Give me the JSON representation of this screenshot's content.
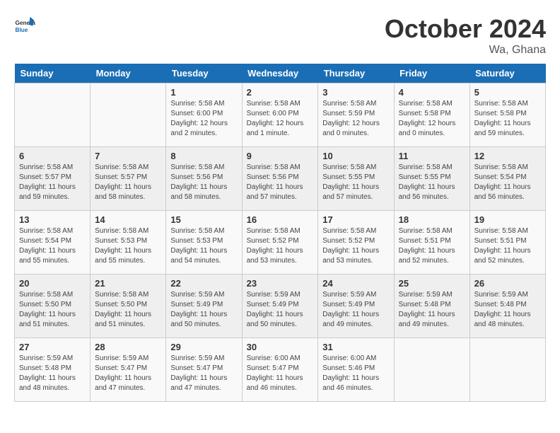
{
  "header": {
    "logo": {
      "line1": "General",
      "line2": "Blue"
    },
    "title": "October 2024",
    "location": "Wa, Ghana"
  },
  "weekdays": [
    "Sunday",
    "Monday",
    "Tuesday",
    "Wednesday",
    "Thursday",
    "Friday",
    "Saturday"
  ],
  "weeks": [
    [
      null,
      null,
      {
        "day": 1,
        "sunrise": "5:58 AM",
        "sunset": "6:00 PM",
        "daylight": "12 hours and 2 minutes."
      },
      {
        "day": 2,
        "sunrise": "5:58 AM",
        "sunset": "6:00 PM",
        "daylight": "12 hours and 1 minute."
      },
      {
        "day": 3,
        "sunrise": "5:58 AM",
        "sunset": "5:59 PM",
        "daylight": "12 hours and 0 minutes."
      },
      {
        "day": 4,
        "sunrise": "5:58 AM",
        "sunset": "5:58 PM",
        "daylight": "12 hours and 0 minutes."
      },
      {
        "day": 5,
        "sunrise": "5:58 AM",
        "sunset": "5:58 PM",
        "daylight": "11 hours and 59 minutes."
      }
    ],
    [
      {
        "day": 6,
        "sunrise": "5:58 AM",
        "sunset": "5:57 PM",
        "daylight": "11 hours and 59 minutes."
      },
      {
        "day": 7,
        "sunrise": "5:58 AM",
        "sunset": "5:57 PM",
        "daylight": "11 hours and 58 minutes."
      },
      {
        "day": 8,
        "sunrise": "5:58 AM",
        "sunset": "5:56 PM",
        "daylight": "11 hours and 58 minutes."
      },
      {
        "day": 9,
        "sunrise": "5:58 AM",
        "sunset": "5:56 PM",
        "daylight": "11 hours and 57 minutes."
      },
      {
        "day": 10,
        "sunrise": "5:58 AM",
        "sunset": "5:55 PM",
        "daylight": "11 hours and 57 minutes."
      },
      {
        "day": 11,
        "sunrise": "5:58 AM",
        "sunset": "5:55 PM",
        "daylight": "11 hours and 56 minutes."
      },
      {
        "day": 12,
        "sunrise": "5:58 AM",
        "sunset": "5:54 PM",
        "daylight": "11 hours and 56 minutes."
      }
    ],
    [
      {
        "day": 13,
        "sunrise": "5:58 AM",
        "sunset": "5:54 PM",
        "daylight": "11 hours and 55 minutes."
      },
      {
        "day": 14,
        "sunrise": "5:58 AM",
        "sunset": "5:53 PM",
        "daylight": "11 hours and 55 minutes."
      },
      {
        "day": 15,
        "sunrise": "5:58 AM",
        "sunset": "5:53 PM",
        "daylight": "11 hours and 54 minutes."
      },
      {
        "day": 16,
        "sunrise": "5:58 AM",
        "sunset": "5:52 PM",
        "daylight": "11 hours and 53 minutes."
      },
      {
        "day": 17,
        "sunrise": "5:58 AM",
        "sunset": "5:52 PM",
        "daylight": "11 hours and 53 minutes."
      },
      {
        "day": 18,
        "sunrise": "5:58 AM",
        "sunset": "5:51 PM",
        "daylight": "11 hours and 52 minutes."
      },
      {
        "day": 19,
        "sunrise": "5:58 AM",
        "sunset": "5:51 PM",
        "daylight": "11 hours and 52 minutes."
      }
    ],
    [
      {
        "day": 20,
        "sunrise": "5:58 AM",
        "sunset": "5:50 PM",
        "daylight": "11 hours and 51 minutes."
      },
      {
        "day": 21,
        "sunrise": "5:58 AM",
        "sunset": "5:50 PM",
        "daylight": "11 hours and 51 minutes."
      },
      {
        "day": 22,
        "sunrise": "5:59 AM",
        "sunset": "5:49 PM",
        "daylight": "11 hours and 50 minutes."
      },
      {
        "day": 23,
        "sunrise": "5:59 AM",
        "sunset": "5:49 PM",
        "daylight": "11 hours and 50 minutes."
      },
      {
        "day": 24,
        "sunrise": "5:59 AM",
        "sunset": "5:49 PM",
        "daylight": "11 hours and 49 minutes."
      },
      {
        "day": 25,
        "sunrise": "5:59 AM",
        "sunset": "5:48 PM",
        "daylight": "11 hours and 49 minutes."
      },
      {
        "day": 26,
        "sunrise": "5:59 AM",
        "sunset": "5:48 PM",
        "daylight": "11 hours and 48 minutes."
      }
    ],
    [
      {
        "day": 27,
        "sunrise": "5:59 AM",
        "sunset": "5:48 PM",
        "daylight": "11 hours and 48 minutes."
      },
      {
        "day": 28,
        "sunrise": "5:59 AM",
        "sunset": "5:47 PM",
        "daylight": "11 hours and 47 minutes."
      },
      {
        "day": 29,
        "sunrise": "5:59 AM",
        "sunset": "5:47 PM",
        "daylight": "11 hours and 47 minutes."
      },
      {
        "day": 30,
        "sunrise": "6:00 AM",
        "sunset": "5:47 PM",
        "daylight": "11 hours and 46 minutes."
      },
      {
        "day": 31,
        "sunrise": "6:00 AM",
        "sunset": "5:46 PM",
        "daylight": "11 hours and 46 minutes."
      },
      null,
      null
    ]
  ]
}
